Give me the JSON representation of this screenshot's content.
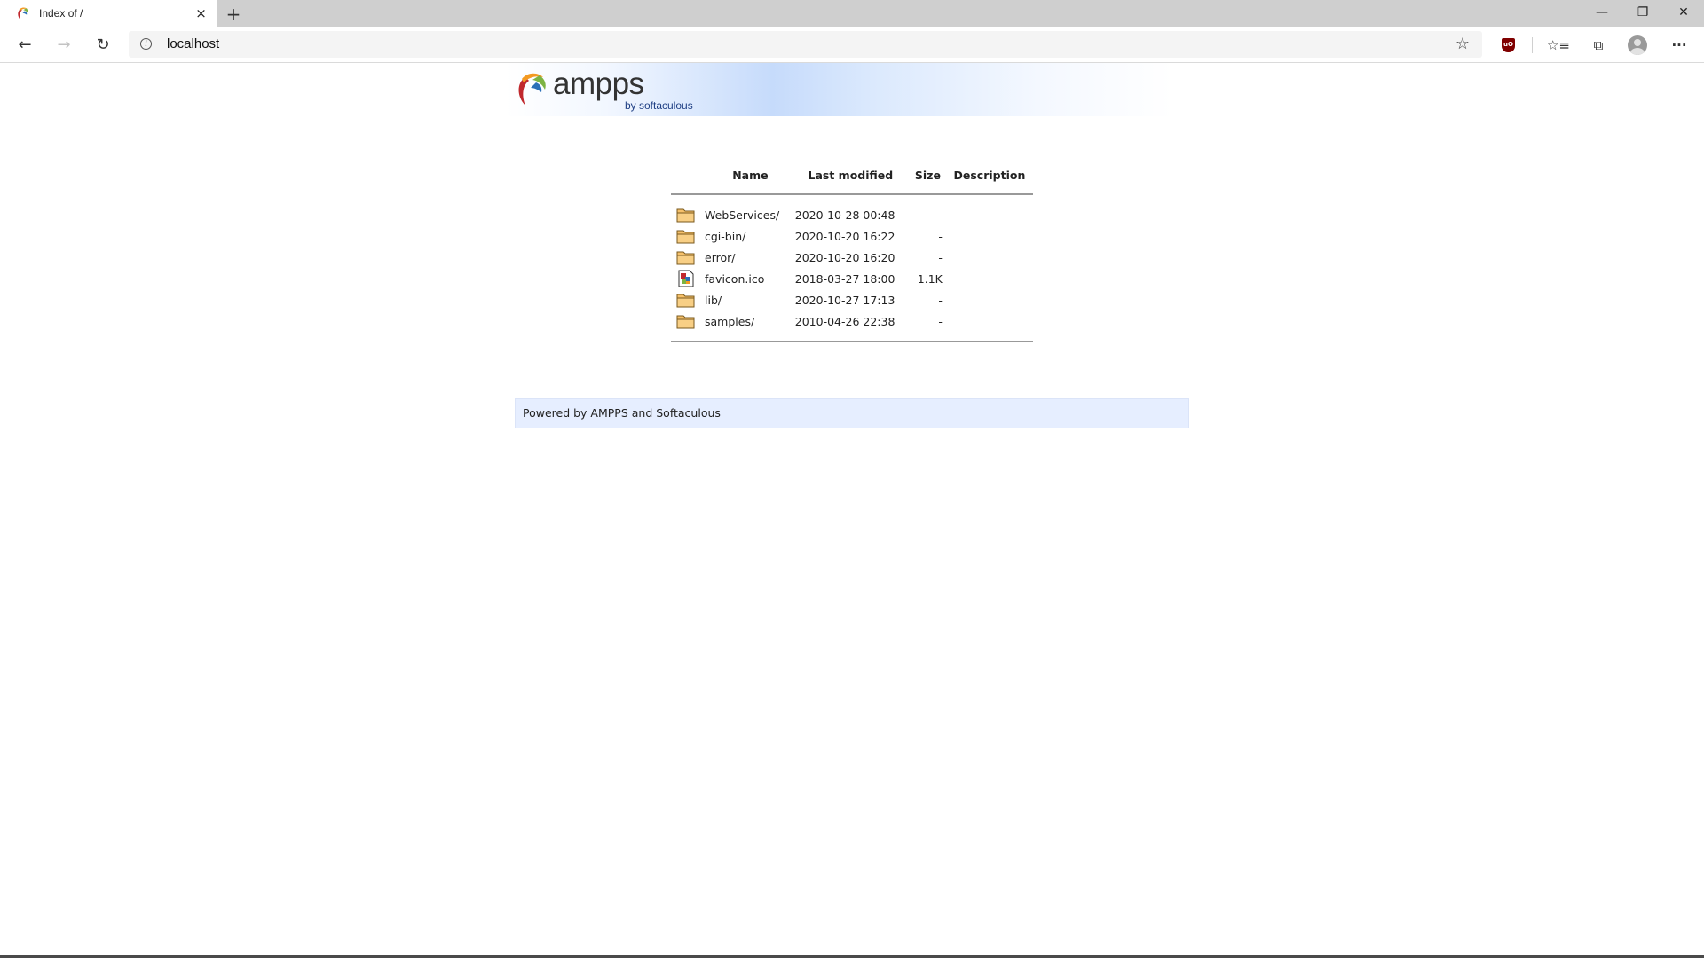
{
  "browser": {
    "tab_title": "Index of /",
    "tab_close": "×",
    "new_tab": "+",
    "url": "localhost",
    "window_controls": {
      "minimize": "—",
      "maximize": "❐",
      "close": "✕"
    },
    "icons": {
      "back": "←",
      "forward": "→",
      "reload": "↻",
      "info": "i",
      "favorite": "☆",
      "ublock": "uO",
      "favorites_list": "☆≡",
      "collections": "⧉",
      "more": "···"
    }
  },
  "banner": {
    "logo_word": "ampps",
    "logo_tagline": "by softaculous"
  },
  "listing": {
    "headers": {
      "name": "Name",
      "modified": "Last modified",
      "size": "Size",
      "description": "Description"
    },
    "rows": [
      {
        "icon": "folder-icon",
        "name": "WebServices/",
        "modified": "2020-10-28 00:48",
        "size": "-",
        "description": ""
      },
      {
        "icon": "folder-icon",
        "name": "cgi-bin/",
        "modified": "2020-10-20 16:22",
        "size": "-",
        "description": ""
      },
      {
        "icon": "folder-icon",
        "name": "error/",
        "modified": "2020-10-20 16:20",
        "size": "-",
        "description": ""
      },
      {
        "icon": "image-file-icon",
        "name": "favicon.ico",
        "modified": "2018-03-27 18:00",
        "size": "1.1K",
        "description": ""
      },
      {
        "icon": "folder-icon",
        "name": "lib/",
        "modified": "2020-10-27 17:13",
        "size": "-",
        "description": ""
      },
      {
        "icon": "folder-icon",
        "name": "samples/",
        "modified": "2010-04-26 22:38",
        "size": "-",
        "description": ""
      }
    ]
  },
  "footer": {
    "text": "Powered by AMPPS and Softaculous"
  },
  "colors": {
    "footer_background": "#e6eeff",
    "folder": "#f5c06a",
    "logo_red": "#c0282d",
    "logo_orange": "#f39a22",
    "logo_green": "#7cb342",
    "logo_blue": "#2a6fb8"
  }
}
